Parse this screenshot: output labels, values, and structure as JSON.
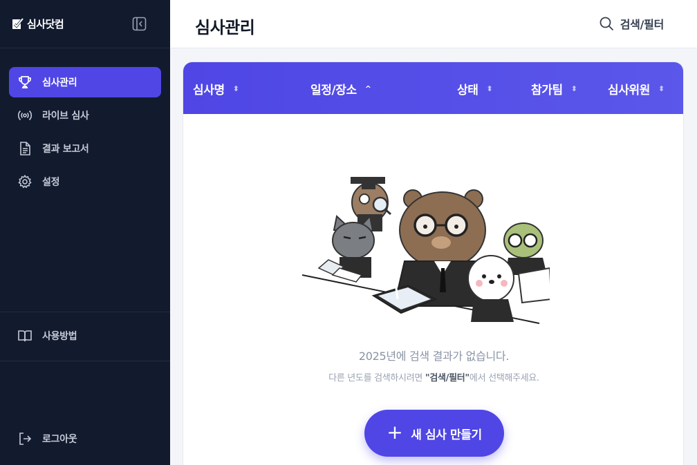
{
  "sidebar": {
    "brand": "심사닷컴",
    "nav": [
      {
        "label": "심사관리",
        "icon": "trophy-icon",
        "active": true
      },
      {
        "label": "라이브 심사",
        "icon": "broadcast-icon",
        "active": false
      },
      {
        "label": "결과 보고서",
        "icon": "document-icon",
        "active": false
      },
      {
        "label": "설정",
        "icon": "gear-icon",
        "active": false
      }
    ],
    "help": {
      "label": "사용방법",
      "icon": "book-icon"
    },
    "logout": {
      "label": "로그아웃",
      "icon": "logout-icon"
    }
  },
  "header": {
    "title": "심사관리",
    "search_label": "검색/필터"
  },
  "table": {
    "columns": [
      {
        "label": "심사명",
        "sort": "none"
      },
      {
        "label": "일정/장소",
        "sort": "asc"
      },
      {
        "label": "상태",
        "sort": "none"
      },
      {
        "label": "참가팀",
        "sort": "none"
      },
      {
        "label": "심사위원",
        "sort": "none"
      }
    ]
  },
  "empty": {
    "title": "2025년에 검색 결과가 없습니다.",
    "sub_before": "다른 년도를 검색하시려면 ",
    "sub_strong": "\"검색/필터\"",
    "sub_after": "에서 선택해주세요.",
    "button_label": "새 심사 만들기"
  },
  "colors": {
    "accent": "#4f46e5",
    "sidebar_bg": "#121a2e"
  }
}
